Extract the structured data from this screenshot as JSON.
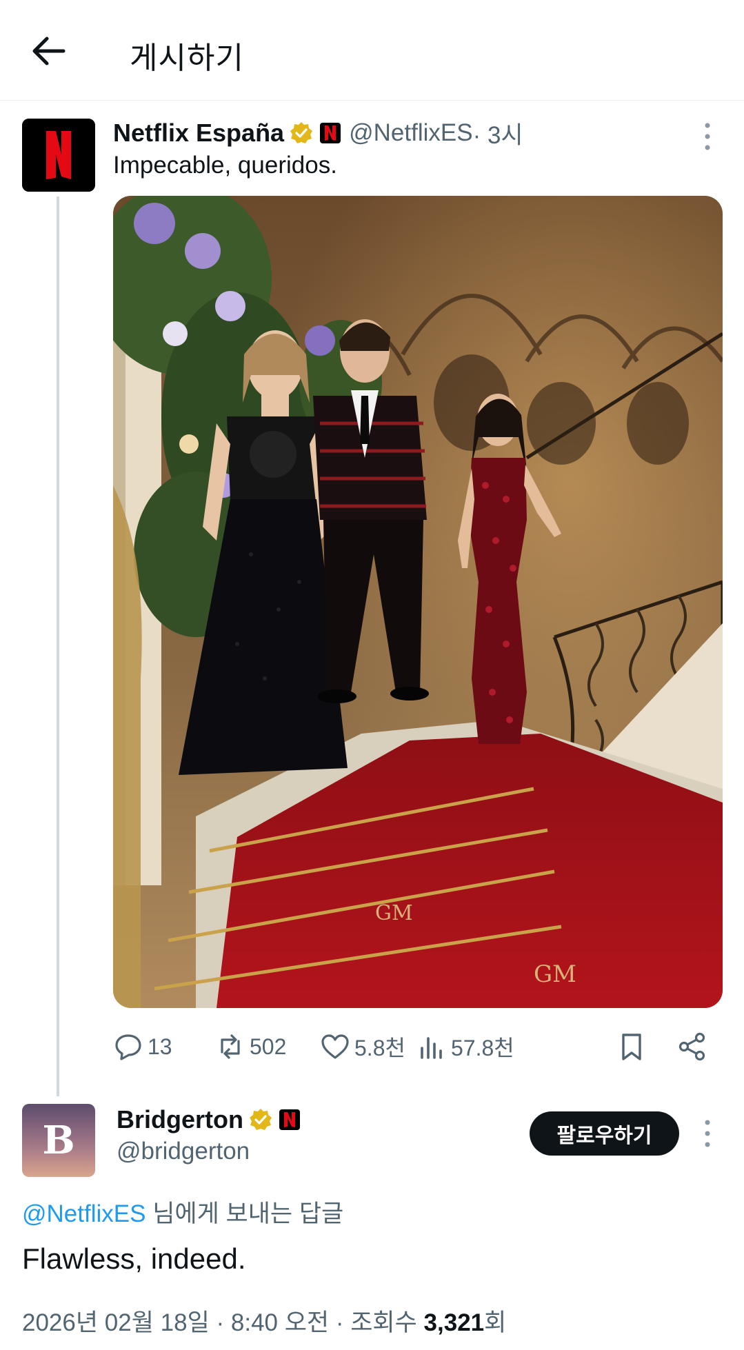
{
  "header": {
    "title": "게시하기",
    "back_icon": "arrow-left-icon"
  },
  "post": {
    "author_name": "Netflix España",
    "handle": "@NetflixES",
    "time": "· 3시",
    "text": "Impecable, queridos.",
    "avatar_letter": "N",
    "badge": "verified-gold-badge",
    "colors": {
      "netflix_red": "#e50914",
      "badge_gold": "#e2b719"
    }
  },
  "actions": {
    "replies": "13",
    "reposts": "502",
    "likes": "5.8천",
    "views": "57.8천"
  },
  "reply": {
    "author_name": "Bridgerton",
    "handle": "@bridgerton",
    "avatar_letter": "B",
    "follow_label": "팔로우하기",
    "replying_to_mention": "@NetflixES",
    "replying_to_suffix": " 님에게 보내는 답글",
    "text": "Flawless, indeed.",
    "meta_prefix": "2026년 02월 18일 · 8:40 오전 · 조회수 ",
    "views_count": "3,321",
    "views_suffix": "회"
  }
}
